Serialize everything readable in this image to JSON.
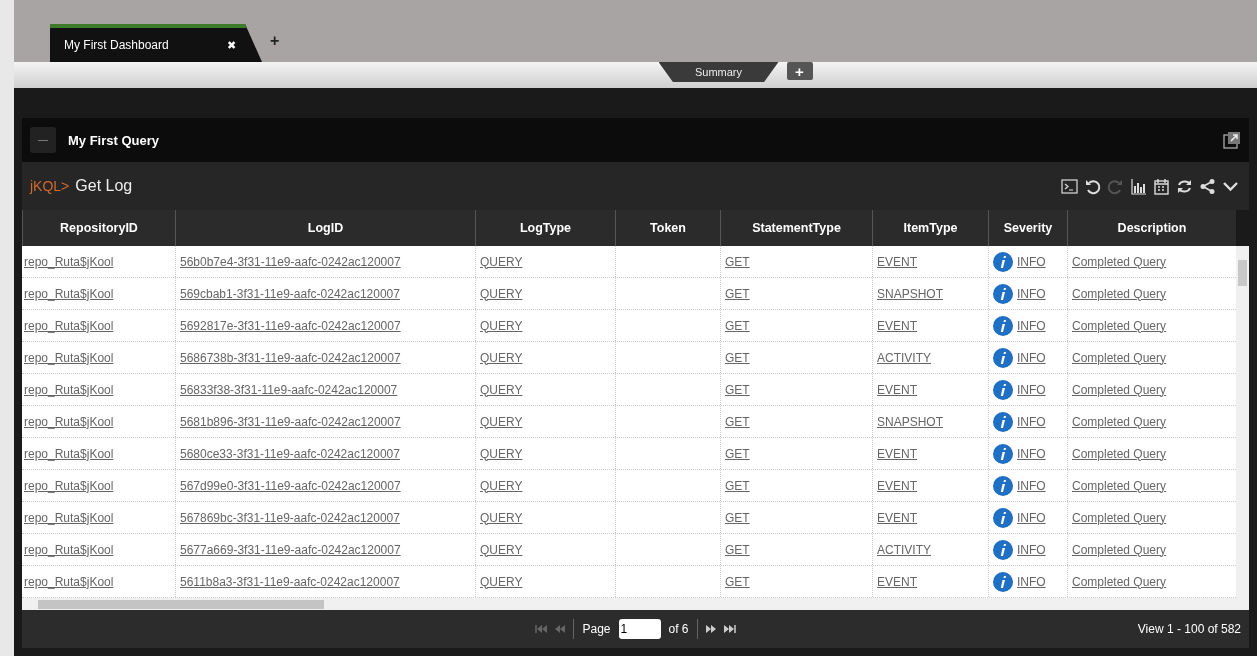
{
  "dashboard_tabs": [
    {
      "label": "My First Dashboard",
      "close": "✖",
      "selected": true
    }
  ],
  "add_dashboard": "+",
  "sheet_tabs": [
    {
      "label": "Summary",
      "selected": true
    }
  ],
  "add_sheet": "+",
  "panel": {
    "title": "My First Query"
  },
  "query": {
    "prompt": "jKQL>",
    "name": "Get Log",
    "tools": [
      {
        "kind": "terminal",
        "disabled": false
      },
      {
        "kind": "undo",
        "disabled": false
      },
      {
        "kind": "redo",
        "disabled": true
      },
      {
        "kind": "chart",
        "disabled": false
      },
      {
        "kind": "calendar",
        "disabled": false
      },
      {
        "kind": "refresh",
        "disabled": false
      },
      {
        "kind": "share",
        "disabled": false
      },
      {
        "kind": "collapse",
        "disabled": false
      }
    ]
  },
  "table": {
    "columns": [
      "RepositoryID",
      "LogID",
      "LogType",
      "Token",
      "StatementType",
      "ItemType",
      "Severity",
      "Description"
    ],
    "rows": [
      {
        "repository": "repo_Ruta$jKool",
        "log_id": "56b0b7e4-3f31-11e9-aafc-0242ac120007",
        "log_type": "QUERY",
        "statement_type": "GET",
        "item_type": "EVENT",
        "severity": "INFO",
        "description": "Completed Query"
      },
      {
        "repository": "repo_Ruta$jKool",
        "log_id": "569cbab1-3f31-11e9-aafc-0242ac120007",
        "log_type": "QUERY",
        "statement_type": "GET",
        "item_type": "SNAPSHOT",
        "severity": "INFO",
        "description": "Completed Query"
      },
      {
        "repository": "repo_Ruta$jKool",
        "log_id": "5692817e-3f31-11e9-aafc-0242ac120007",
        "log_type": "QUERY",
        "statement_type": "GET",
        "item_type": "EVENT",
        "severity": "INFO",
        "description": "Completed Query"
      },
      {
        "repository": "repo_Ruta$jKool",
        "log_id": "5686738b-3f31-11e9-aafc-0242ac120007",
        "log_type": "QUERY",
        "statement_type": "GET",
        "item_type": "ACTIVITY",
        "severity": "INFO",
        "description": "Completed Query"
      },
      {
        "repository": "repo_Ruta$jKool",
        "log_id": "56833f38-3f31-11e9-aafc-0242ac120007",
        "log_type": "QUERY",
        "statement_type": "GET",
        "item_type": "EVENT",
        "severity": "INFO",
        "description": "Completed Query"
      },
      {
        "repository": "repo_Ruta$jKool",
        "log_id": "5681b896-3f31-11e9-aafc-0242ac120007",
        "log_type": "QUERY",
        "statement_type": "GET",
        "item_type": "SNAPSHOT",
        "severity": "INFO",
        "description": "Completed Query"
      },
      {
        "repository": "repo_Ruta$jKool",
        "log_id": "5680ce33-3f31-11e9-aafc-0242ac120007",
        "log_type": "QUERY",
        "statement_type": "GET",
        "item_type": "EVENT",
        "severity": "INFO",
        "description": "Completed Query"
      },
      {
        "repository": "repo_Ruta$jKool",
        "log_id": "567d99e0-3f31-11e9-aafc-0242ac120007",
        "log_type": "QUERY",
        "statement_type": "GET",
        "item_type": "EVENT",
        "severity": "INFO",
        "description": "Completed Query"
      },
      {
        "repository": "repo_Ruta$jKool",
        "log_id": "567869bc-3f31-11e9-aafc-0242ac120007",
        "log_type": "QUERY",
        "statement_type": "GET",
        "item_type": "EVENT",
        "severity": "INFO",
        "description": "Completed Query"
      },
      {
        "repository": "repo_Ruta$jKool",
        "log_id": "5677a669-3f31-11e9-aafc-0242ac120007",
        "log_type": "QUERY",
        "statement_type": "GET",
        "item_type": "ACTIVITY",
        "severity": "INFO",
        "description": "Completed Query"
      },
      {
        "repository": "repo_Ruta$jKool",
        "log_id": "5611b8a3-3f31-11e9-aafc-0242ac120007",
        "log_type": "QUERY",
        "statement_type": "GET",
        "item_type": "EVENT",
        "severity": "INFO",
        "description": "Completed Query"
      }
    ]
  },
  "pager": {
    "first_disabled": true,
    "prev_disabled": true,
    "next_disabled": false,
    "last_disabled": false,
    "page_label": "Page",
    "page": "1",
    "of_label": "of 6",
    "view": "View 1 - 100 of 582"
  }
}
